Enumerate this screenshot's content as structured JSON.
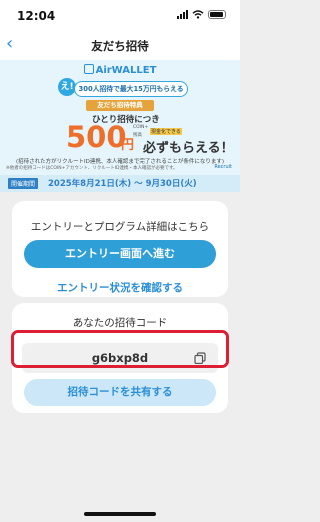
{
  "status_bar": {
    "time": "12:04"
  },
  "nav": {
    "back_glyph": "‹",
    "title": "友だち招待"
  },
  "banner": {
    "brand": "AirWALLET",
    "e_badge": "え!",
    "headline": "300人招待で最大15万円もらえるの!?",
    "tokuten_label": "友だち招待特典",
    "per_person": "ひとり招待につき",
    "amount": "500",
    "yen": "円",
    "coin_small1": "COIN+",
    "coin_small2": "残高",
    "coin_small3": "現金化できる",
    "gets": "必ずもらえる！",
    "note": "(招待された方がリクルートID連携、本人確認まで完了されることが条件になります)",
    "note_small": "※他者の招待コードはCOIN+アカウント、リクルートID連携・本人確認が必要です。",
    "recruit": "Recruit",
    "period_label": "開催期間",
    "period": "2025年8月21日(木) ～ 9月30日(火)"
  },
  "entry_card": {
    "title": "エントリーとプログラム詳細はこちら",
    "primary_button": "エントリー画面へ進む",
    "status_link": "エントリー状況を確認する"
  },
  "invite_card": {
    "title": "あなたの招待コード",
    "code": "g6bxp8d",
    "copy_icon": "copy-icon",
    "share_button": "招待コードを共有する"
  },
  "colors": {
    "accent": "#2f9fd8",
    "highlight": "#dd1e34",
    "promo_orange": "#ee6f2a"
  }
}
